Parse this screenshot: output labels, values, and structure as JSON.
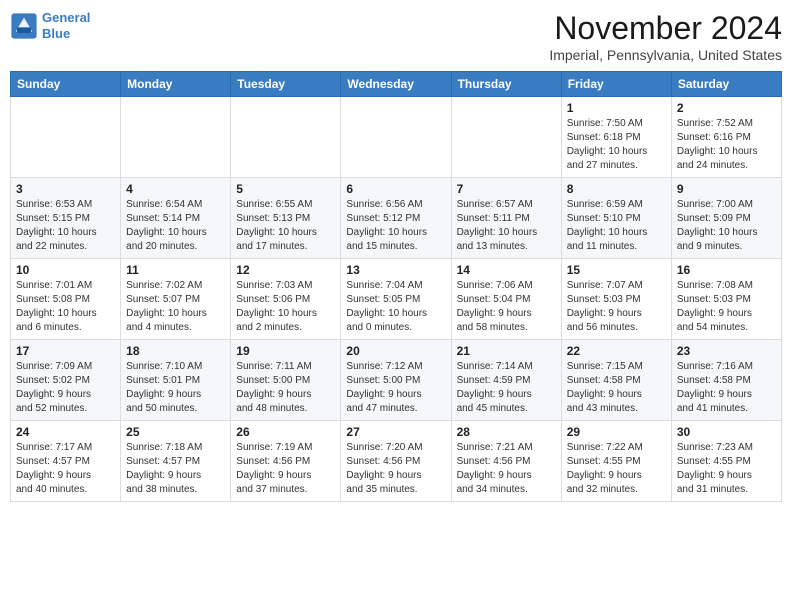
{
  "header": {
    "logo_line1": "General",
    "logo_line2": "Blue",
    "month": "November 2024",
    "location": "Imperial, Pennsylvania, United States"
  },
  "weekdays": [
    "Sunday",
    "Monday",
    "Tuesday",
    "Wednesday",
    "Thursday",
    "Friday",
    "Saturday"
  ],
  "rows": [
    [
      {
        "day": "",
        "info": ""
      },
      {
        "day": "",
        "info": ""
      },
      {
        "day": "",
        "info": ""
      },
      {
        "day": "",
        "info": ""
      },
      {
        "day": "",
        "info": ""
      },
      {
        "day": "1",
        "info": "Sunrise: 7:50 AM\nSunset: 6:18 PM\nDaylight: 10 hours\nand 27 minutes."
      },
      {
        "day": "2",
        "info": "Sunrise: 7:52 AM\nSunset: 6:16 PM\nDaylight: 10 hours\nand 24 minutes."
      }
    ],
    [
      {
        "day": "3",
        "info": "Sunrise: 6:53 AM\nSunset: 5:15 PM\nDaylight: 10 hours\nand 22 minutes."
      },
      {
        "day": "4",
        "info": "Sunrise: 6:54 AM\nSunset: 5:14 PM\nDaylight: 10 hours\nand 20 minutes."
      },
      {
        "day": "5",
        "info": "Sunrise: 6:55 AM\nSunset: 5:13 PM\nDaylight: 10 hours\nand 17 minutes."
      },
      {
        "day": "6",
        "info": "Sunrise: 6:56 AM\nSunset: 5:12 PM\nDaylight: 10 hours\nand 15 minutes."
      },
      {
        "day": "7",
        "info": "Sunrise: 6:57 AM\nSunset: 5:11 PM\nDaylight: 10 hours\nand 13 minutes."
      },
      {
        "day": "8",
        "info": "Sunrise: 6:59 AM\nSunset: 5:10 PM\nDaylight: 10 hours\nand 11 minutes."
      },
      {
        "day": "9",
        "info": "Sunrise: 7:00 AM\nSunset: 5:09 PM\nDaylight: 10 hours\nand 9 minutes."
      }
    ],
    [
      {
        "day": "10",
        "info": "Sunrise: 7:01 AM\nSunset: 5:08 PM\nDaylight: 10 hours\nand 6 minutes."
      },
      {
        "day": "11",
        "info": "Sunrise: 7:02 AM\nSunset: 5:07 PM\nDaylight: 10 hours\nand 4 minutes."
      },
      {
        "day": "12",
        "info": "Sunrise: 7:03 AM\nSunset: 5:06 PM\nDaylight: 10 hours\nand 2 minutes."
      },
      {
        "day": "13",
        "info": "Sunrise: 7:04 AM\nSunset: 5:05 PM\nDaylight: 10 hours\nand 0 minutes."
      },
      {
        "day": "14",
        "info": "Sunrise: 7:06 AM\nSunset: 5:04 PM\nDaylight: 9 hours\nand 58 minutes."
      },
      {
        "day": "15",
        "info": "Sunrise: 7:07 AM\nSunset: 5:03 PM\nDaylight: 9 hours\nand 56 minutes."
      },
      {
        "day": "16",
        "info": "Sunrise: 7:08 AM\nSunset: 5:03 PM\nDaylight: 9 hours\nand 54 minutes."
      }
    ],
    [
      {
        "day": "17",
        "info": "Sunrise: 7:09 AM\nSunset: 5:02 PM\nDaylight: 9 hours\nand 52 minutes."
      },
      {
        "day": "18",
        "info": "Sunrise: 7:10 AM\nSunset: 5:01 PM\nDaylight: 9 hours\nand 50 minutes."
      },
      {
        "day": "19",
        "info": "Sunrise: 7:11 AM\nSunset: 5:00 PM\nDaylight: 9 hours\nand 48 minutes."
      },
      {
        "day": "20",
        "info": "Sunrise: 7:12 AM\nSunset: 5:00 PM\nDaylight: 9 hours\nand 47 minutes."
      },
      {
        "day": "21",
        "info": "Sunrise: 7:14 AM\nSunset: 4:59 PM\nDaylight: 9 hours\nand 45 minutes."
      },
      {
        "day": "22",
        "info": "Sunrise: 7:15 AM\nSunset: 4:58 PM\nDaylight: 9 hours\nand 43 minutes."
      },
      {
        "day": "23",
        "info": "Sunrise: 7:16 AM\nSunset: 4:58 PM\nDaylight: 9 hours\nand 41 minutes."
      }
    ],
    [
      {
        "day": "24",
        "info": "Sunrise: 7:17 AM\nSunset: 4:57 PM\nDaylight: 9 hours\nand 40 minutes."
      },
      {
        "day": "25",
        "info": "Sunrise: 7:18 AM\nSunset: 4:57 PM\nDaylight: 9 hours\nand 38 minutes."
      },
      {
        "day": "26",
        "info": "Sunrise: 7:19 AM\nSunset: 4:56 PM\nDaylight: 9 hours\nand 37 minutes."
      },
      {
        "day": "27",
        "info": "Sunrise: 7:20 AM\nSunset: 4:56 PM\nDaylight: 9 hours\nand 35 minutes."
      },
      {
        "day": "28",
        "info": "Sunrise: 7:21 AM\nSunset: 4:56 PM\nDaylight: 9 hours\nand 34 minutes."
      },
      {
        "day": "29",
        "info": "Sunrise: 7:22 AM\nSunset: 4:55 PM\nDaylight: 9 hours\nand 32 minutes."
      },
      {
        "day": "30",
        "info": "Sunrise: 7:23 AM\nSunset: 4:55 PM\nDaylight: 9 hours\nand 31 minutes."
      }
    ]
  ]
}
